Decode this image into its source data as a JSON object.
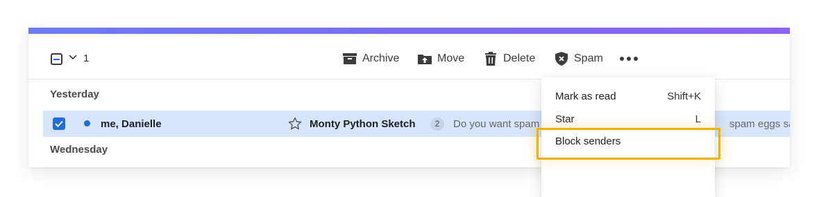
{
  "toolbar": {
    "selected_count": "1",
    "archive_label": "Archive",
    "move_label": "Move",
    "delete_label": "Delete",
    "spam_label": "Spam",
    "more_icon": "more-horizontal-icon"
  },
  "groups": {
    "yesterday": "Yesterday",
    "wednesday": "Wednesday"
  },
  "message": {
    "sender": "me, Danielle",
    "subject": "Monty Python Sketch",
    "thread_count": "2",
    "snippet_start": "Do you want spam",
    "snippet_end": "spam eggs saus",
    "selected": true,
    "unread": true
  },
  "menu": {
    "items": [
      {
        "label": "Mark as read",
        "shortcut": "Shift+K"
      },
      {
        "label": "Star",
        "shortcut": "L"
      },
      {
        "label": "Block senders",
        "shortcut": ""
      }
    ]
  },
  "colors": {
    "accent_gradient_start": "#6c7bf2",
    "accent_gradient_end": "#8a63ef",
    "selected_row": "#d7e5fb",
    "checkbox_blue": "#1d6fe0",
    "highlight": "#f5b100"
  }
}
